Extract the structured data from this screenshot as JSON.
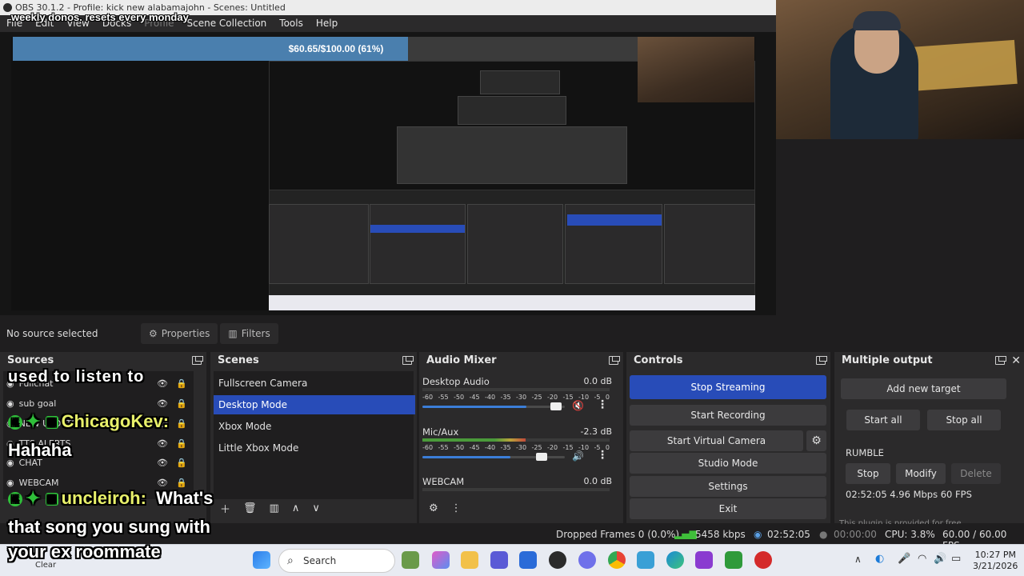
{
  "window": {
    "title": "OBS 30.1.2 - Profile: kick new alabamajohn - Scenes: Untitled"
  },
  "overlay": {
    "donation_text": "weekly donos. resets every monday",
    "goal_text": "$60.65/$100.00 (61%)",
    "goal_progress": 0.61
  },
  "menu": {
    "items": [
      "File",
      "Edit",
      "View",
      "Docks",
      "Profile",
      "Scene Collection",
      "Tools",
      "Help"
    ]
  },
  "source_bar": {
    "no_source": "No source selected",
    "properties_label": "Properties",
    "filters_label": "Filters"
  },
  "sources": {
    "title": "Sources",
    "items": [
      {
        "name": "Fullchat"
      },
      {
        "name": "sub goal"
      },
      {
        "name": "NEW UPDATE"
      },
      {
        "name": "TTS ALERTS"
      },
      {
        "name": "CHAT"
      },
      {
        "name": "WEBCAM"
      }
    ]
  },
  "scenes": {
    "title": "Scenes",
    "items": [
      "Fullscreen Camera",
      "Desktop Mode",
      "Xbox Mode",
      "Little Xbox Mode"
    ],
    "selected": "Desktop Mode"
  },
  "mixer": {
    "title": "Audio Mixer",
    "scale": [
      "-60",
      "-55",
      "-50",
      "-45",
      "-40",
      "-35",
      "-30",
      "-25",
      "-20",
      "-15",
      "-10",
      "-5",
      "0"
    ],
    "channels": [
      {
        "name": "Desktop Audio",
        "db": "0.0 dB",
        "volume": 0.73,
        "muted": true
      },
      {
        "name": "Mic/Aux",
        "db": "-2.3 dB",
        "volume": 0.62,
        "muted": false,
        "level": 0.55
      },
      {
        "name": "WEBCAM",
        "db": "0.0 dB",
        "volume": 0.73,
        "muted": false
      }
    ]
  },
  "controls": {
    "title": "Controls",
    "stop_streaming": "Stop Streaming",
    "start_recording": "Start Recording",
    "start_virtual_camera": "Start Virtual Camera",
    "studio_mode": "Studio Mode",
    "settings": "Settings",
    "exit": "Exit"
  },
  "multi": {
    "title": "Multiple output",
    "add_target": "Add new target",
    "start_all": "Start all",
    "stop_all": "Stop all",
    "target_name": "RUMBLE",
    "stop": "Stop",
    "modify": "Modify",
    "delete": "Delete",
    "stats": "02:52:05  4.96 Mbps  60 FPS",
    "footer": "This plugin is provided for free"
  },
  "status": {
    "dropped": "Dropped Frames 0 (0.0%)",
    "bitrate": "5458 kbps",
    "stream_time": "02:52:05",
    "rec_time": "00:00:00",
    "cpu": "CPU: 3.8%",
    "fps": "60.00 / 60.00 FPS"
  },
  "chat_overlay": {
    "line1": "used to listen to",
    "user1": "ChicagoKev:",
    "msg1": "Hahaha",
    "user2": "uncleiroh:",
    "msg2a": "What's",
    "msg2b": "that song you sung with",
    "msg2c": "your ex roommate"
  },
  "taskbar": {
    "search": "Search",
    "time": "10:27 PM",
    "date": "3/21/2026",
    "weather": "Clear"
  },
  "colors": {
    "accent": "#284cb8",
    "panel": "#2b2a2b",
    "background": "#1f1e1f",
    "goal_fill": "#4a7fae"
  }
}
